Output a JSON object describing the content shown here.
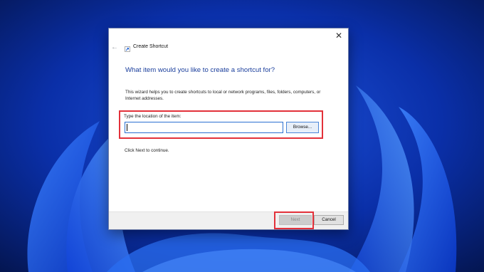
{
  "dialog": {
    "title": "Create Shortcut",
    "heading": "What item would you like to create a shortcut for?",
    "description": "This wizard helps you to create shortcuts to local or network programs, files, folders, computers, or Internet addresses.",
    "location_label": "Type the location of the item:",
    "location_value": "",
    "browse_label": "Browse...",
    "continue_text": "Click Next to continue.",
    "next_label": "Next",
    "cancel_label": "Cancel",
    "close_glyph": "✕",
    "back_glyph": "←"
  },
  "colors": {
    "wallpaper_base": "#0a2fa8",
    "heading": "#1a3e9c",
    "highlight": "#e3313a",
    "input_border": "#2a6fd1"
  },
  "icons": {
    "back": "arrow-left-icon",
    "title": "shortcut-icon",
    "close": "close-icon"
  }
}
